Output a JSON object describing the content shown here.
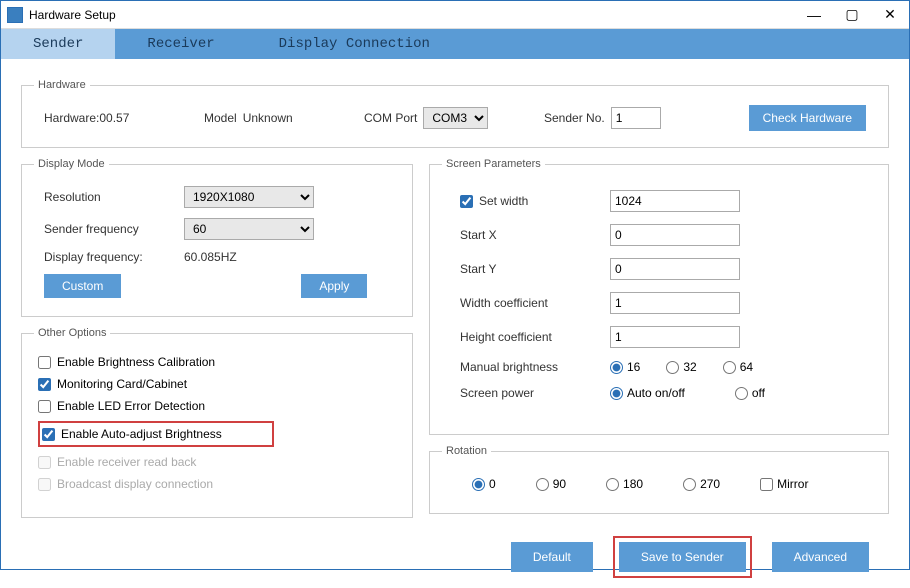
{
  "window": {
    "title": "Hardware Setup"
  },
  "tabs": {
    "sender": "Sender",
    "receiver": "Receiver",
    "display_connection": "Display Connection"
  },
  "hardware": {
    "legend": "Hardware",
    "hw_label": "Hardware:00.57",
    "model_label": "Model",
    "model_value": "Unknown",
    "com_label": "COM Port",
    "com_value": "COM3",
    "sender_no_label": "Sender No.",
    "sender_no_value": "1",
    "check_btn": "Check Hardware"
  },
  "display_mode": {
    "legend": "Display Mode",
    "resolution_label": "Resolution",
    "resolution_value": "1920X1080",
    "sender_freq_label": "Sender frequency",
    "sender_freq_value": "60",
    "display_freq_label": "Display frequency:",
    "display_freq_value": "60.085HZ",
    "custom_btn": "Custom",
    "apply_btn": "Apply"
  },
  "other_options": {
    "legend": "Other Options",
    "brightness_cal": "Enable Brightness Calibration",
    "monitoring": "Monitoring Card/Cabinet",
    "led_error": "Enable LED Error Detection",
    "auto_adjust": "Enable Auto-adjust Brightness",
    "readback": "Enable receiver read back",
    "broadcast": "Broadcast display connection"
  },
  "screen_params": {
    "legend": "Screen Parameters",
    "set_width_label": "Set width",
    "set_width_value": "1024",
    "startx_label": "Start X",
    "startx_value": "0",
    "starty_label": "Start Y",
    "starty_value": "0",
    "wcoef_label": "Width coefficient",
    "wcoef_value": "1",
    "hcoef_label": "Height coefficient",
    "hcoef_value": "1",
    "manual_brightness_label": "Manual brightness",
    "mb16": "16",
    "mb32": "32",
    "mb64": "64",
    "screen_power_label": "Screen power",
    "sp_auto": "Auto on/off",
    "sp_off": "off"
  },
  "rotation": {
    "legend": "Rotation",
    "r0": "0",
    "r90": "90",
    "r180": "180",
    "r270": "270",
    "mirror": "Mirror"
  },
  "footer": {
    "default": "Default",
    "save": "Save to Sender",
    "advanced": "Advanced"
  }
}
